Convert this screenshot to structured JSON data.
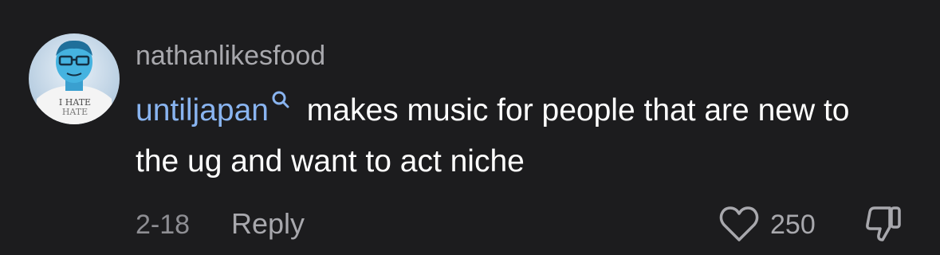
{
  "comment": {
    "username": "nathanlikesfood",
    "mention": "untiljapan",
    "body_text": " makes music for people that are new to the ug and want to act niche",
    "date": "2-18",
    "reply_label": "Reply",
    "like_count": "250",
    "avatar_shirt_text": [
      "I HATE",
      "HATE"
    ]
  },
  "colors": {
    "background": "#1c1c1e",
    "username": "#a8a8ad",
    "mention": "#89b4f0",
    "body": "#ffffff",
    "meta": "#8e8e93"
  },
  "icons": {
    "mention": "search-icon",
    "like": "heart-icon",
    "dislike": "thumbs-down-icon"
  }
}
